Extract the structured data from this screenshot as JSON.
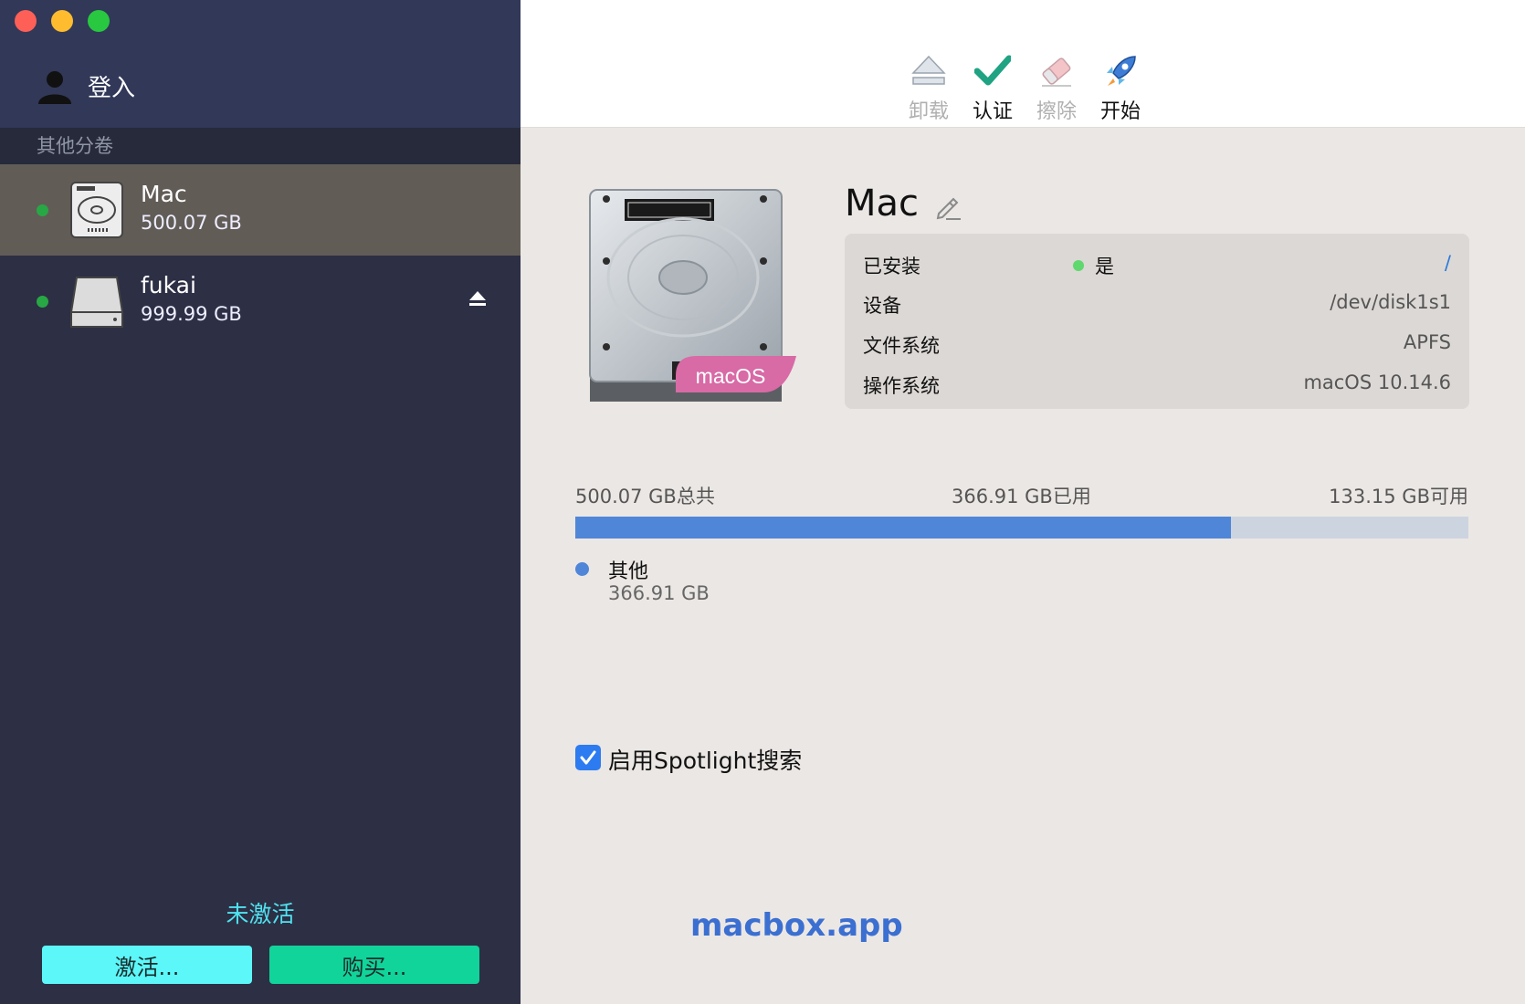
{
  "sidebar": {
    "login_label": "登入",
    "section_header": "其他分卷",
    "volumes": [
      {
        "name": "Mac",
        "size": "500.07 GB"
      },
      {
        "name": "fukai",
        "size": "999.99 GB"
      }
    ],
    "inactive_text": "未激活",
    "activate_label": "激活...",
    "buy_label": "购买..."
  },
  "toolbar": {
    "unmount_label": "卸载",
    "verify_label": "认证",
    "erase_label": "擦除",
    "start_label": "开始"
  },
  "volume": {
    "title": "Mac",
    "badge": "macOS",
    "info": {
      "installed_key": "已安装",
      "installed_value": "是",
      "installed_path": "/",
      "device_key": "设备",
      "device_value": "/dev/disk1s1",
      "fs_key": "文件系统",
      "fs_value": "APFS",
      "os_key": "操作系统",
      "os_value": "macOS 10.14.6"
    }
  },
  "usage": {
    "total_label": "500.07 GB总共",
    "used_label": "366.91 GB已用",
    "free_label": "133.15 GB可用",
    "used_fraction": 0.7337,
    "legend": [
      {
        "name": "其他",
        "size": "366.91 GB"
      }
    ]
  },
  "spotlight_label": "启用Spotlight搜索",
  "watermark": "macbox.app",
  "colors": {
    "sidebar_bg": "#2d2f45",
    "selected_bg": "#625c57",
    "accent_blue": "#4f86d8",
    "badge_pink": "#d86aa6",
    "activate_btn": "#5cf7f9",
    "buy_btn": "#11d49b"
  }
}
